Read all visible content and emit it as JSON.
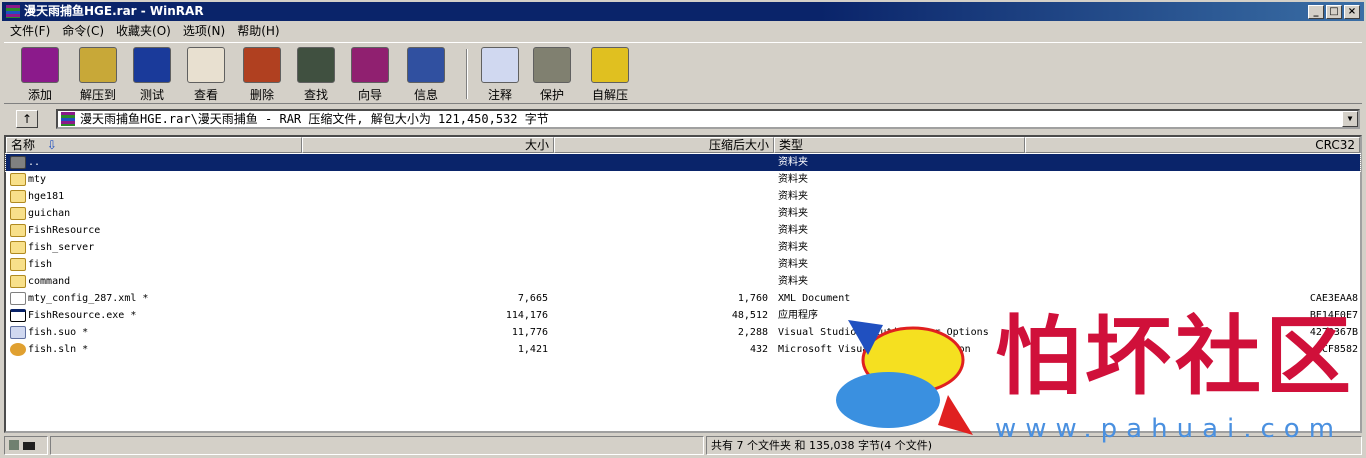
{
  "window": {
    "title": "漫天雨捕鱼HGE.rar - WinRAR",
    "min": "_",
    "max": "□",
    "close": "×"
  },
  "menu": [
    "文件(F)",
    "命令(C)",
    "收藏夹(O)",
    "选项(N)",
    "帮助(H)"
  ],
  "toolbar": [
    {
      "label": "添加",
      "icon": "add-icon",
      "color": "#8b1a8b"
    },
    {
      "label": "解压到",
      "icon": "extract-icon",
      "color": "#c8a838"
    },
    {
      "label": "测试",
      "icon": "test-icon",
      "color": "#1a3a9a"
    },
    {
      "label": "查看",
      "icon": "view-icon",
      "color": "#e8e0d0"
    },
    {
      "label": "删除",
      "icon": "delete-icon",
      "color": "#b04020"
    },
    {
      "label": "查找",
      "icon": "find-icon",
      "color": "#405040"
    },
    {
      "label": "向导",
      "icon": "wizard-icon",
      "color": "#902070"
    },
    {
      "label": "信息",
      "icon": "info-icon",
      "color": "#3050a0"
    },
    {
      "label": "注释",
      "icon": "comment-icon",
      "color": "#d0d8f0"
    },
    {
      "label": "保护",
      "icon": "protect-icon",
      "color": "#808070"
    },
    {
      "label": "自解压",
      "icon": "sfx-icon",
      "color": "#e0c020"
    }
  ],
  "address": {
    "up": "↑",
    "path": "漫天雨捕鱼HGE.rar\\漫天雨捕鱼 - RAR 压缩文件, 解包大小为 121,450,532 字节",
    "dropdown": "▼"
  },
  "columns": [
    "名称",
    "大小",
    "压缩后大小",
    "类型",
    "CRC32"
  ],
  "sort_arrow": "⇩",
  "rows": [
    {
      "name": "..",
      "size": "",
      "packed": "",
      "type": "资料夹",
      "crc": "",
      "kind": "up"
    },
    {
      "name": "mty",
      "size": "",
      "packed": "",
      "type": "资料夹",
      "crc": "",
      "kind": "folder"
    },
    {
      "name": "hge181",
      "size": "",
      "packed": "",
      "type": "资料夹",
      "crc": "",
      "kind": "folder"
    },
    {
      "name": "guichan",
      "size": "",
      "packed": "",
      "type": "资料夹",
      "crc": "",
      "kind": "folder"
    },
    {
      "name": "FishResource",
      "size": "",
      "packed": "",
      "type": "资料夹",
      "crc": "",
      "kind": "folder"
    },
    {
      "name": "fish_server",
      "size": "",
      "packed": "",
      "type": "资料夹",
      "crc": "",
      "kind": "folder"
    },
    {
      "name": "fish",
      "size": "",
      "packed": "",
      "type": "资料夹",
      "crc": "",
      "kind": "folder"
    },
    {
      "name": "command",
      "size": "",
      "packed": "",
      "type": "资料夹",
      "crc": "",
      "kind": "folder"
    },
    {
      "name": "mty_config_287.xml *",
      "size": "7,665",
      "packed": "1,760",
      "type": "XML Document",
      "crc": "CAE3EAA8",
      "kind": "xml"
    },
    {
      "name": "FishResource.exe *",
      "size": "114,176",
      "packed": "48,512",
      "type": "应用程序",
      "crc": "BE14F0E7",
      "kind": "exe"
    },
    {
      "name": "fish.suo *",
      "size": "11,776",
      "packed": "2,288",
      "type": "Visual Studio Solution User Options",
      "crc": "4278367B",
      "kind": "suo"
    },
    {
      "name": "fish.sln *",
      "size": "1,421",
      "packed": "432",
      "type": "Microsoft Visual Studio Solution",
      "crc": "?CF8582",
      "kind": "sln"
    }
  ],
  "status": {
    "summary": "共有 7 个文件夹 和 135,038 字节(4 个文件)"
  },
  "watermark": {
    "text": "怕坏社区",
    "url": "www.pahuai.com"
  }
}
